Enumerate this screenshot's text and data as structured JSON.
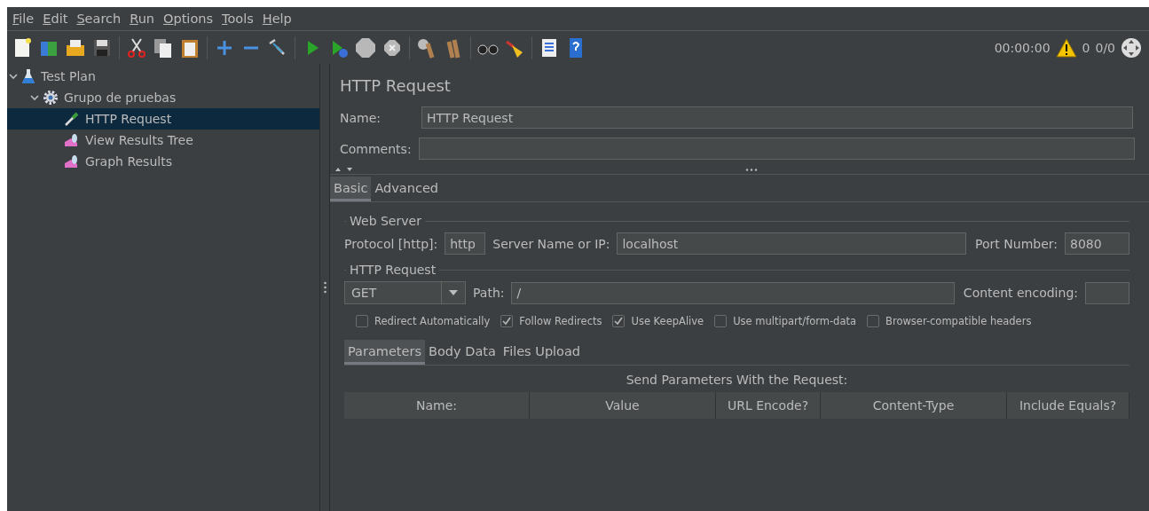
{
  "menu": [
    "File",
    "Edit",
    "Search",
    "Run",
    "Options",
    "Tools",
    "Help"
  ],
  "status": {
    "timer": "00:00:00",
    "warnings": "0",
    "threads": "0/0"
  },
  "tree": [
    {
      "label": "Test Plan",
      "kind": "test-plan",
      "expanded": true,
      "selected": false,
      "children": [
        {
          "label": "Grupo de pruebas",
          "kind": "thread-group",
          "expanded": true,
          "selected": false,
          "children": [
            {
              "label": "HTTP Request",
              "kind": "sampler",
              "selected": true
            },
            {
              "label": "View Results Tree",
              "kind": "listener",
              "selected": false
            },
            {
              "label": "Graph Results",
              "kind": "listener",
              "selected": false
            }
          ]
        }
      ]
    }
  ],
  "title": "HTTP Request",
  "name_field": {
    "label": "Name:",
    "value": "HTTP Request"
  },
  "comments_field": {
    "label": "Comments:"
  },
  "tabs": [
    {
      "label": "Basic",
      "selected": true
    },
    {
      "label": "Advanced",
      "selected": false
    }
  ],
  "web_server": {
    "legend": "Web Server",
    "protocol": {
      "label": "Protocol [http]:",
      "value": "http"
    },
    "server": {
      "label": "Server Name or IP:",
      "value": "localhost"
    },
    "port": {
      "label": "Port Number:",
      "value": "8080"
    }
  },
  "http_request": {
    "legend": "HTTP Request",
    "method": "GET",
    "path": {
      "label": "Path:",
      "value": "/"
    },
    "encoding": {
      "label": "Content encoding:"
    }
  },
  "options": [
    {
      "label": "Redirect Automatically",
      "checked": false
    },
    {
      "label": "Follow Redirects",
      "checked": true
    },
    {
      "label": "Use KeepAlive",
      "checked": true
    },
    {
      "label": "Use multipart/form-data",
      "checked": false
    },
    {
      "label": "Browser-compatible headers",
      "checked": false
    }
  ],
  "sub_tabs": [
    {
      "label": "Parameters",
      "selected": true
    },
    {
      "label": "Body Data",
      "selected": false
    },
    {
      "label": "Files Upload",
      "selected": false
    }
  ],
  "params_caption": "Send Parameters With the Request:",
  "columns": [
    "Name:",
    "Value",
    "URL Encode?",
    "Content-Type",
    "Include Equals?"
  ]
}
